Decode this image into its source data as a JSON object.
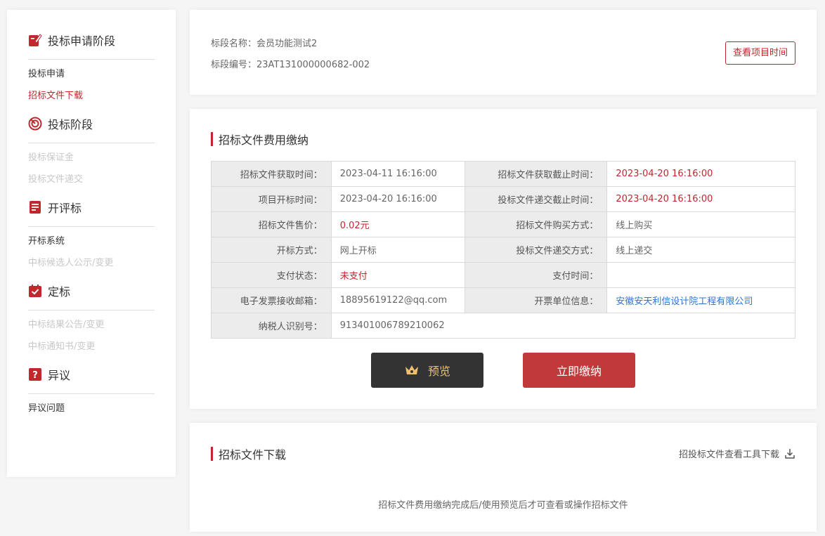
{
  "sidebar": {
    "sections": [
      {
        "title": "投标申请阶段",
        "icon": "edit-doc-icon",
        "items": [
          {
            "label": "投标申请",
            "state": "normal"
          },
          {
            "label": "招标文件下载",
            "state": "active"
          }
        ]
      },
      {
        "title": "投标阶段",
        "icon": "target-icon",
        "items": [
          {
            "label": "投标保证金",
            "state": "disabled"
          },
          {
            "label": "投标文件递交",
            "state": "disabled"
          }
        ]
      },
      {
        "title": "开评标",
        "icon": "document-list-icon",
        "items": [
          {
            "label": "开标系统",
            "state": "normal"
          },
          {
            "label": "中标候选人公示/变更",
            "state": "disabled"
          }
        ]
      },
      {
        "title": "定标",
        "icon": "calendar-check-icon",
        "items": [
          {
            "label": "中标结果公告/变更",
            "state": "disabled"
          },
          {
            "label": "中标通知书/变更",
            "state": "disabled"
          }
        ]
      },
      {
        "title": "异议",
        "icon": "question-icon",
        "items": [
          {
            "label": "异议问题",
            "state": "normal"
          }
        ]
      }
    ]
  },
  "info": {
    "name_label": "标段名称：",
    "name_value": "会员功能测试2",
    "code_label": "标段编号：",
    "code_value": "23AT131000000682-002",
    "time_button": "查看项目时间"
  },
  "fee": {
    "title": "招标文件费用缴纳",
    "rows": [
      [
        {
          "label": "招标文件获取时间：",
          "value": "2023-04-11 16:16:00"
        },
        {
          "label": "招标文件获取截止时间：",
          "value": "2023-04-20 16:16:00",
          "style": "red"
        }
      ],
      [
        {
          "label": "项目开标时间：",
          "value": "2023-04-20 16:16:00"
        },
        {
          "label": "投标文件递交截止时间：",
          "value": "2023-04-20 16:16:00",
          "style": "red"
        }
      ],
      [
        {
          "label": "招标文件售价：",
          "value": "0.02元",
          "style": "red"
        },
        {
          "label": "招标文件购买方式：",
          "value": "线上购买"
        }
      ],
      [
        {
          "label": "开标方式：",
          "value": "网上开标"
        },
        {
          "label": "投标文件递交方式：",
          "value": "线上递交"
        }
      ],
      [
        {
          "label": "支付状态：",
          "value": "未支付",
          "style": "red"
        },
        {
          "label": "支付时间：",
          "value": ""
        }
      ],
      [
        {
          "label": "电子发票接收邮箱：",
          "value": "18895619122@qq.com"
        },
        {
          "label": "开票单位信息：",
          "value": "安徽安天利信设计院工程有限公司",
          "style": "blue"
        }
      ],
      [
        {
          "label": "纳税人识别号：",
          "value": "913401006789210062"
        }
      ]
    ],
    "preview_button": "预览",
    "pay_button": "立即缴纳"
  },
  "download": {
    "title": "招标文件下载",
    "tool_link": "招投标文件查看工具下载",
    "note": "招标文件费用缴纳完成后/使用预览后才可查看或操作招标文件"
  },
  "colors": {
    "accent": "#c0282e",
    "link": "#2f72d6",
    "preview_bg": "#333333",
    "preview_text": "#e8c27a"
  }
}
